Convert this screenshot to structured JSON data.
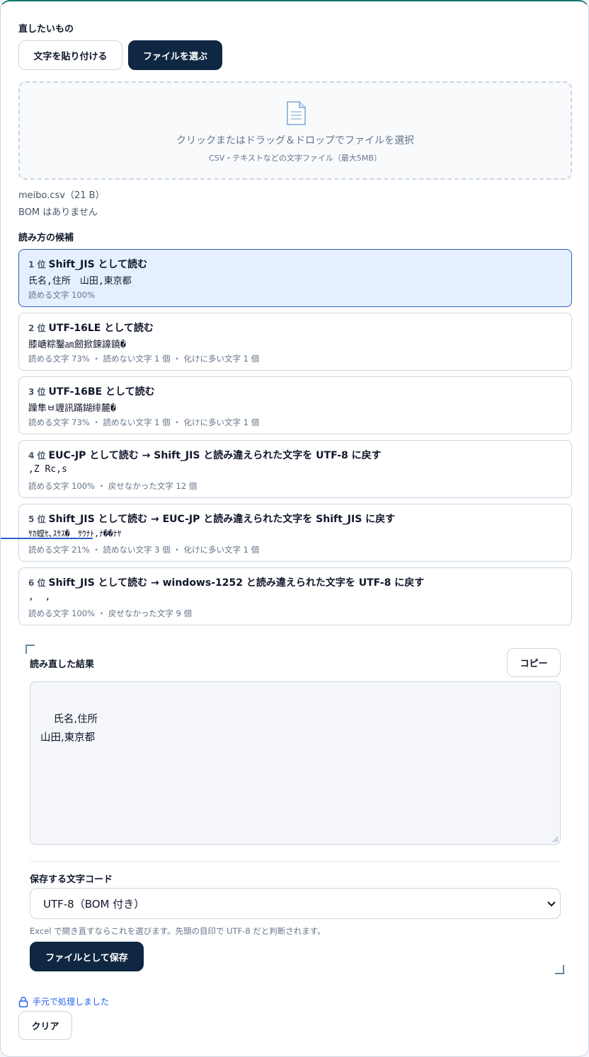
{
  "input_section": {
    "label": "直したいもの",
    "paste_button": "文字を貼り付ける",
    "file_button": "ファイルを選ぶ"
  },
  "dropzone": {
    "icon": "document-icon",
    "main_text": "クリックまたはドラッグ＆ドロップでファイルを選択",
    "sub_text": "CSV・テキストなどの文字ファイル（最大5MB）"
  },
  "file_info": {
    "name_size": "meibo.csv（21 B）",
    "bom": "BOM はありません"
  },
  "candidates_section": {
    "label": "読み方の候補",
    "items": [
      {
        "rank": "1 位",
        "title": "Shift_JIS として読む",
        "preview": "氏名,住所　山田,東京都",
        "stats": "読める文字 100%",
        "selected": true
      },
      {
        "rank": "2 位",
        "title": "UTF-16LE として読む",
        "preview": "膝嵣粽鑿㏂劒掀鋉譹鐃�",
        "stats": "読める文字 73% ・ 読めない文字 1 個 ・ 化けに多い文字 1 個",
        "selected": false
      },
      {
        "rank": "3 位",
        "title": "UTF-16BE として読む",
        "preview": "躁隼ㅂ竰訊蹣鍸绯麓�",
        "stats": "読める文字 73% ・ 読めない文字 1 個 ・ 化けに多い文字 1 個",
        "selected": false
      },
      {
        "rank": "4 位",
        "title": "EUC-JP として読む → Shift_JIS と読み違えられた文字を UTF-8 に戻す",
        "preview": ",Z Rc,s",
        "stats": "読める文字 100% ・ 戻せなかった文字 12 個",
        "selected": false
      },
      {
        "rank": "5 位",
        "title": "Shift_JIS として読む → EUC-JP と読み違えられた文字を Shift_JIS に戻す",
        "preview": "ｻｶ螳ｾ､ｽｻｽ�　ｻｳﾅﾄ,ﾅ��ﾅﾔ",
        "stats": "読める文字 21% ・ 読めない文字 3 個 ・ 化けに多い文字 1 個",
        "selected": false
      },
      {
        "rank": "6 位",
        "title": "Shift_JIS として読む → windows-1252 と読み違えられた文字を UTF-8 に戻す",
        "preview": ",  ,",
        "stats": "読める文字 100% ・ 戻せなかった文字 9 個",
        "selected": false
      }
    ]
  },
  "result": {
    "label": "読み直した結果",
    "copy_button": "コピー",
    "text": "氏名,住所\n山田,東京都"
  },
  "save": {
    "label": "保存する文字コード",
    "selected_option": "UTF-8（BOM 付き）",
    "hint": "Excel で開き直すならこれを選びます。先頭の目印で UTF-8 だと判断されます。",
    "save_button": "ファイルとして保存"
  },
  "footer": {
    "local_text": "手元で処理しました",
    "clear_button": "クリア"
  },
  "colors": {
    "primary_dark": "#0f2742",
    "selected_bg": "#e6efff",
    "selected_border": "#2f5ec4",
    "accent_top": "#0f766e",
    "link_blue": "#2563eb"
  }
}
